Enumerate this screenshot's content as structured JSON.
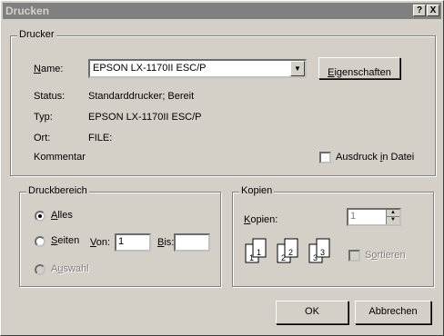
{
  "title": "Drucken",
  "titlebar": {
    "help": "?",
    "close": "X"
  },
  "printer": {
    "legend": "Drucker",
    "name_label": "Name:",
    "name_value": "EPSON LX-1170II ESC/P",
    "properties_button": "Eigenschaften",
    "status_label": "Status:",
    "status_value": "Standarddrucker; Bereit",
    "type_label": "Typ:",
    "type_value": "EPSON LX-1170II ESC/P",
    "location_label": "Ort:",
    "location_value": "FILE:",
    "comment_label": "Kommentar",
    "print_to_file": "Ausdruck in Datei"
  },
  "range": {
    "legend": "Druckbereich",
    "all": "Alles",
    "pages": "Seiten",
    "from_label": "Von:",
    "from_value": "1",
    "to_label": "Bis:",
    "to_value": "",
    "selection": "Auswahl"
  },
  "copies": {
    "legend": "Kopien",
    "copies_label": "Kopien:",
    "copies_value": "1",
    "collate": "Sortieren",
    "icon_pages": [
      "1",
      "1",
      "2",
      "2",
      "3",
      "3"
    ]
  },
  "buttons": {
    "ok": "OK",
    "cancel": "Abbrechen"
  }
}
